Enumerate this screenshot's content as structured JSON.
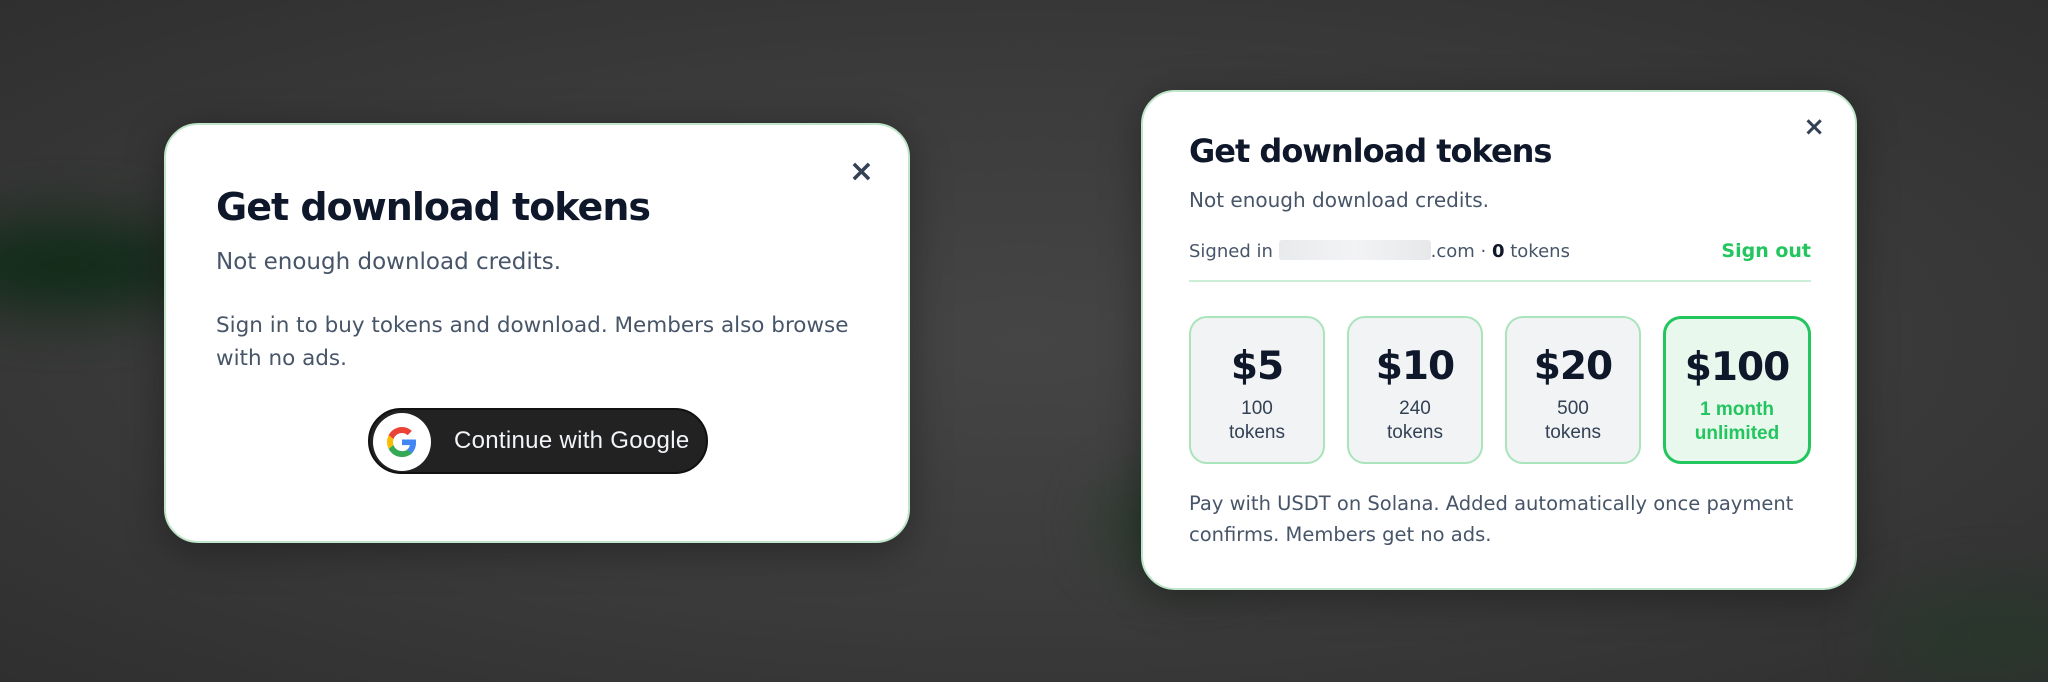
{
  "colors": {
    "accent_green": "#22c55e",
    "dark_button": "#222222",
    "title_text": "#0f172a",
    "body_text": "#475569",
    "backdrop": "#3b3b3b"
  },
  "left_modal": {
    "close_icon": "×",
    "title": "Get download tokens",
    "subtitle": "Not enough download credits.",
    "description": "Sign in to buy tokens and download. Members also browse with no ads.",
    "google_button_label": "Continue with Google",
    "google_icon": "google-g-icon"
  },
  "right_modal": {
    "close_icon": "×",
    "title": "Get download tokens",
    "subtitle": "Not enough download credits.",
    "signed_in_prefix": "Signed in",
    "email_suffix": ".com",
    "separator": " · ",
    "token_count": "0",
    "tokens_suffix": " tokens",
    "sign_out": "Sign out",
    "plans": [
      {
        "price": "$5",
        "line1": "100",
        "line2": "tokens"
      },
      {
        "price": "$10",
        "line1": "240",
        "line2": "tokens"
      },
      {
        "price": "$20",
        "line1": "500",
        "line2": "tokens"
      },
      {
        "price": "$100",
        "line1": "1 month",
        "line2": "unlimited"
      }
    ],
    "footnote": "Pay with USDT on Solana. Added automatically once payment confirms. Members get no ads."
  }
}
